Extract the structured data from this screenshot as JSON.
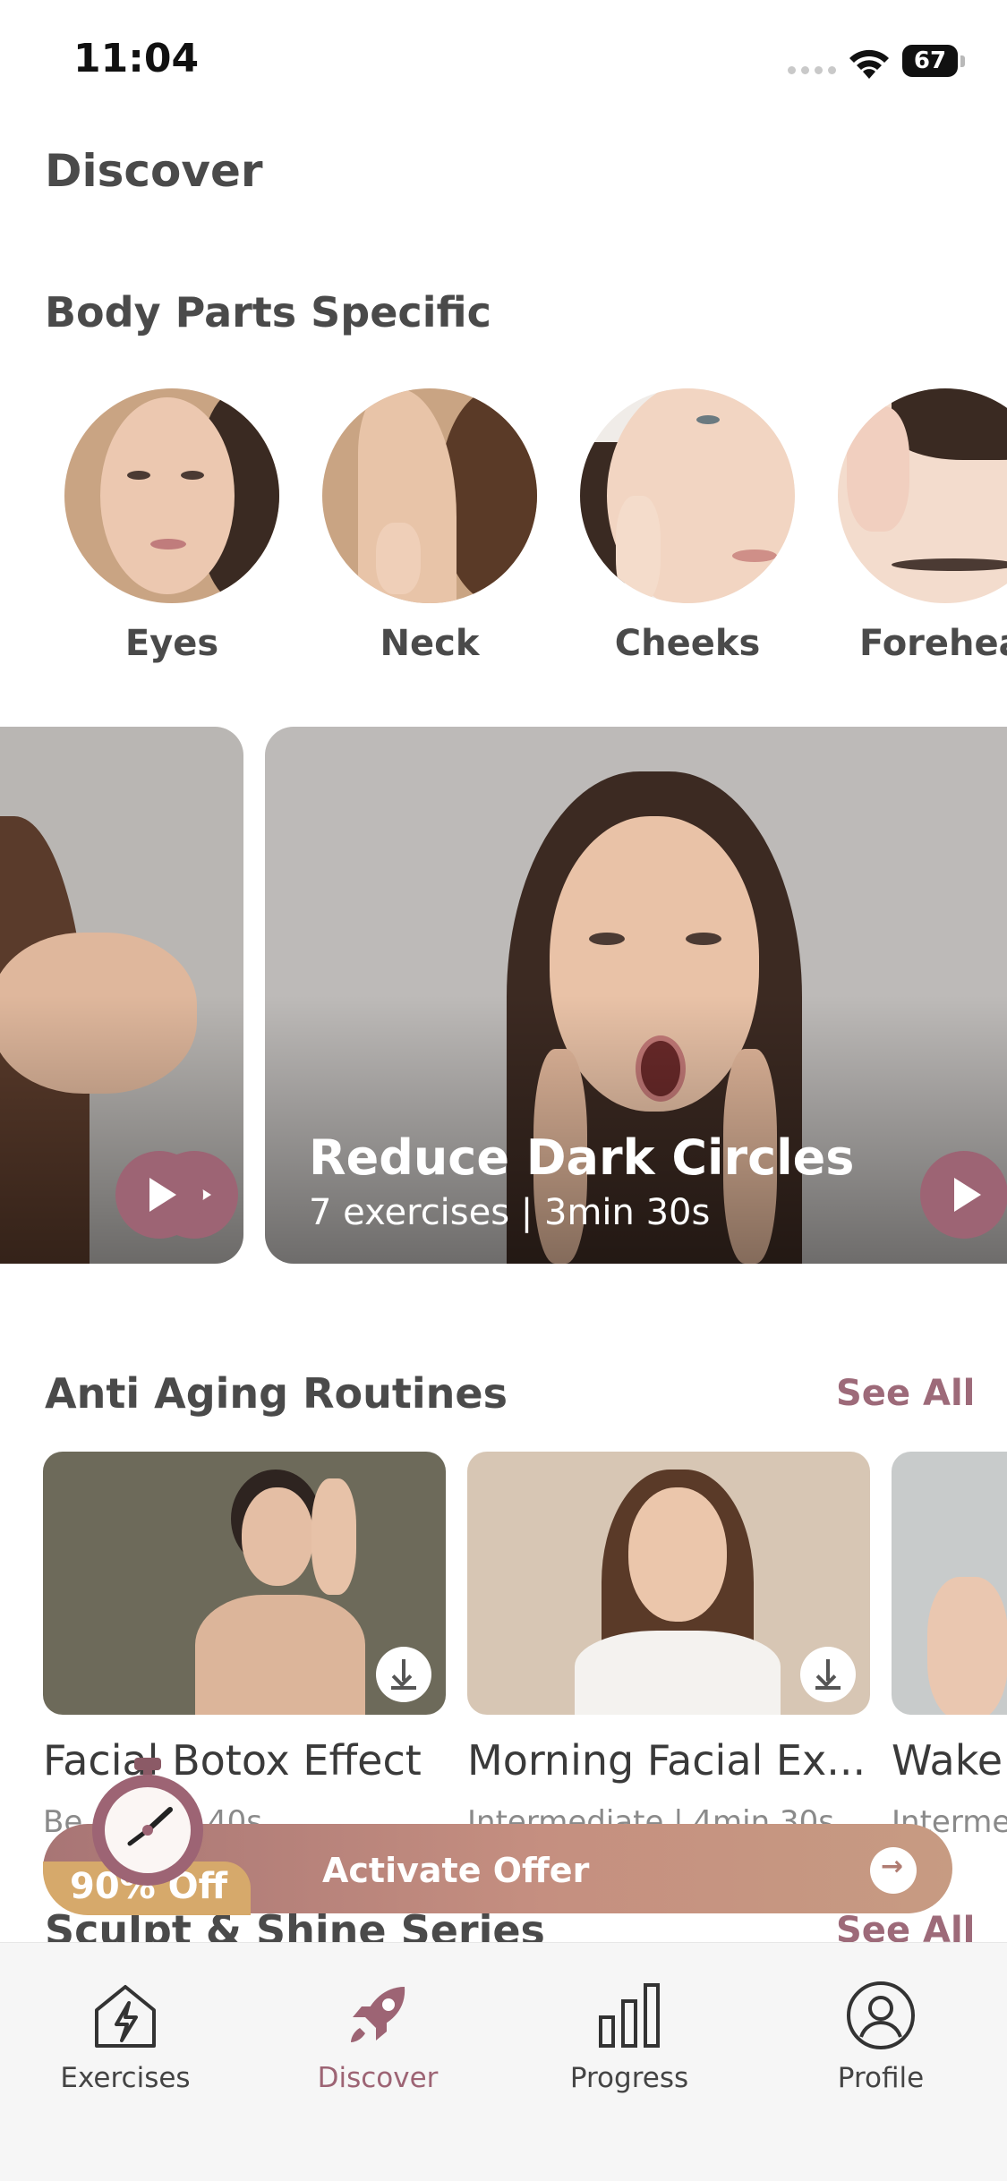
{
  "status": {
    "time": "11:04",
    "battery": "67"
  },
  "page": {
    "title": "Discover"
  },
  "body_parts": {
    "title": "Body Parts Specific",
    "items": [
      {
        "label": "Eyes"
      },
      {
        "label": "Neck"
      },
      {
        "label": "Cheeks"
      },
      {
        "label": "Forehea"
      }
    ]
  },
  "featured": {
    "title": "Reduce Dark Circles",
    "subtitle": "7 exercises | 3min 30s"
  },
  "anti_aging": {
    "title": "Anti Aging Routines",
    "see_all": "See All",
    "items": [
      {
        "name": "Facial Botox Effect",
        "meta": "Be...  6min 40s"
      },
      {
        "name": "Morning Facial Ex...",
        "meta": "Intermediate  |  4min 30s"
      },
      {
        "name": "Wake",
        "meta": "Interme"
      }
    ]
  },
  "sculpt": {
    "title": "Sculpt & Shine Series",
    "see_all": "See All"
  },
  "offer": {
    "badge": "90% Off",
    "label": "Activate Offer"
  },
  "tabs": [
    {
      "label": "Exercises"
    },
    {
      "label": "Discover"
    },
    {
      "label": "Progress"
    },
    {
      "label": "Profile"
    }
  ],
  "colors": {
    "accent": "#9d6474",
    "offer_badge": "#d6a96b"
  }
}
